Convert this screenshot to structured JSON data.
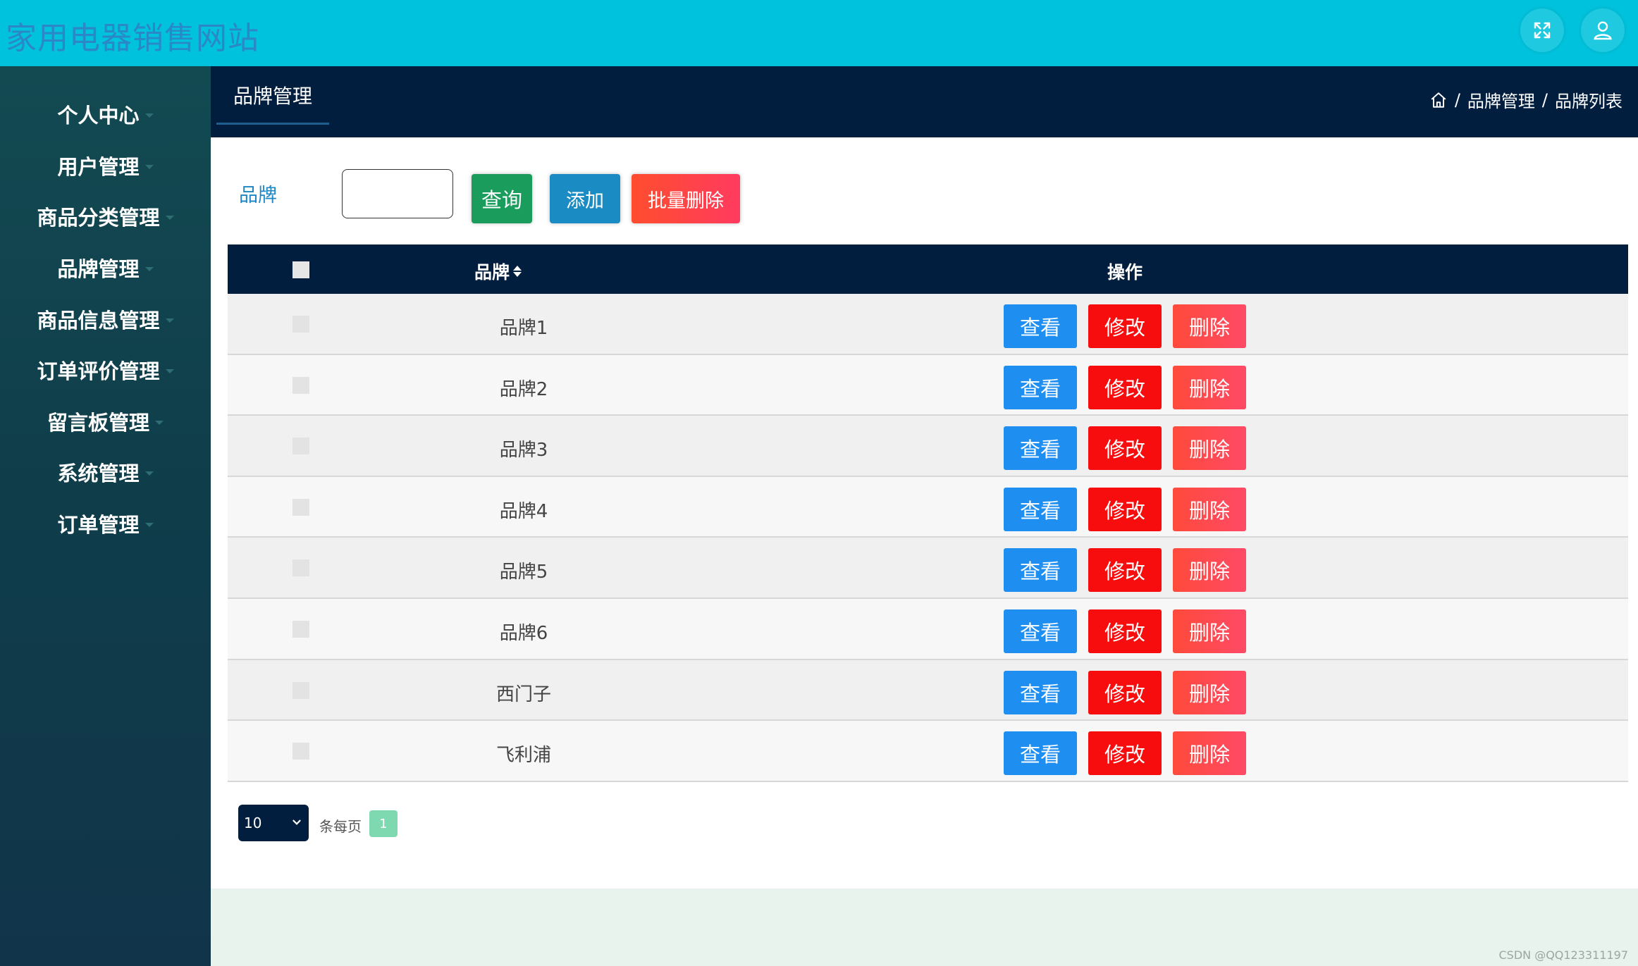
{
  "header": {
    "site_title": "家用电器销售网站"
  },
  "sidebar": {
    "items": [
      {
        "label": "个人中心"
      },
      {
        "label": "用户管理"
      },
      {
        "label": "商品分类管理"
      },
      {
        "label": "品牌管理"
      },
      {
        "label": "商品信息管理"
      },
      {
        "label": "订单评价管理"
      },
      {
        "label": "留言板管理"
      },
      {
        "label": "系统管理"
      },
      {
        "label": "订单管理"
      }
    ]
  },
  "subheader": {
    "active_tab": "品牌管理",
    "breadcrumb": [
      "品牌管理",
      "品牌列表"
    ]
  },
  "search": {
    "label": "品牌",
    "value": "",
    "query_label": "查询",
    "add_label": "添加",
    "batch_delete_label": "批量删除"
  },
  "table": {
    "columns": [
      "品牌",
      "操作"
    ],
    "rows": [
      {
        "brand": "品牌1"
      },
      {
        "brand": "品牌2"
      },
      {
        "brand": "品牌3"
      },
      {
        "brand": "品牌4"
      },
      {
        "brand": "品牌5"
      },
      {
        "brand": "品牌6"
      },
      {
        "brand": "西门子"
      },
      {
        "brand": "飞利浦"
      }
    ],
    "actions": {
      "view": "查看",
      "edit": "修改",
      "delete": "删除"
    }
  },
  "pagination": {
    "page_size": "10",
    "per_page_label": "条每页",
    "current_page": "1"
  },
  "watermark": "CSDN @QQ123311197",
  "colors": {
    "topbar": "#00c2dc",
    "sidebar": "#134a52",
    "dark_header": "#011e3f",
    "view_button": "#1e8ff0",
    "edit_button": "#f70d0d",
    "delete_button": "#ff4a4f",
    "query_button": "#1a9c5c",
    "add_button": "#1b8bc3"
  }
}
